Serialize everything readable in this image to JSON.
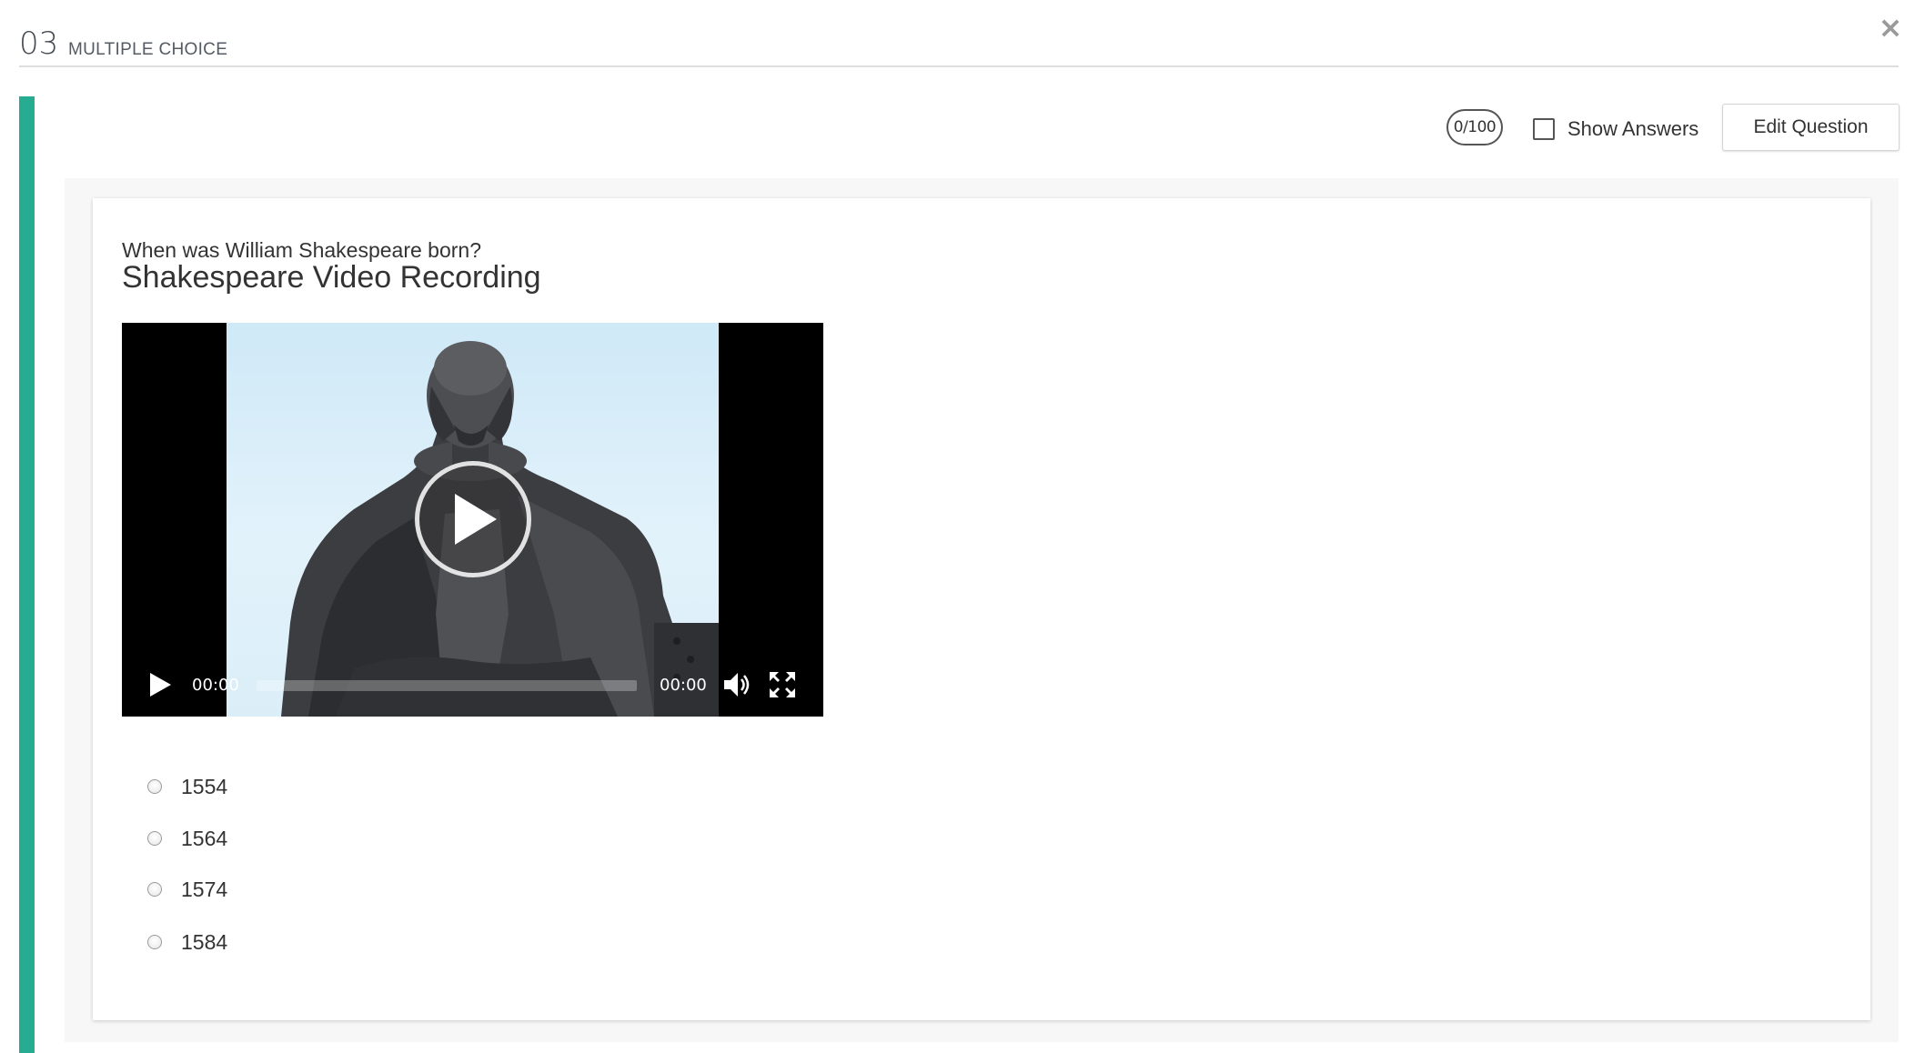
{
  "header": {
    "number": "03",
    "type": "MULTIPLE CHOICE",
    "close_label": "×"
  },
  "toolbar": {
    "points": "0/100",
    "show_answers_label": "Show Answers",
    "show_answers_checked": false,
    "edit_label": "Edit Question"
  },
  "question": {
    "prompt": "When was William Shakespeare born?",
    "title": "Shakespeare Video Recording"
  },
  "video": {
    "current_time": "00:00",
    "duration": "00:00",
    "progress": 0
  },
  "options": [
    {
      "label": "1554",
      "selected": false
    },
    {
      "label": "1564",
      "selected": false
    },
    {
      "label": "1574",
      "selected": false
    },
    {
      "label": "1584",
      "selected": false
    }
  ],
  "colors": {
    "accent": "#26ad91",
    "panel": "#f7f7f7",
    "text": "#333333"
  }
}
